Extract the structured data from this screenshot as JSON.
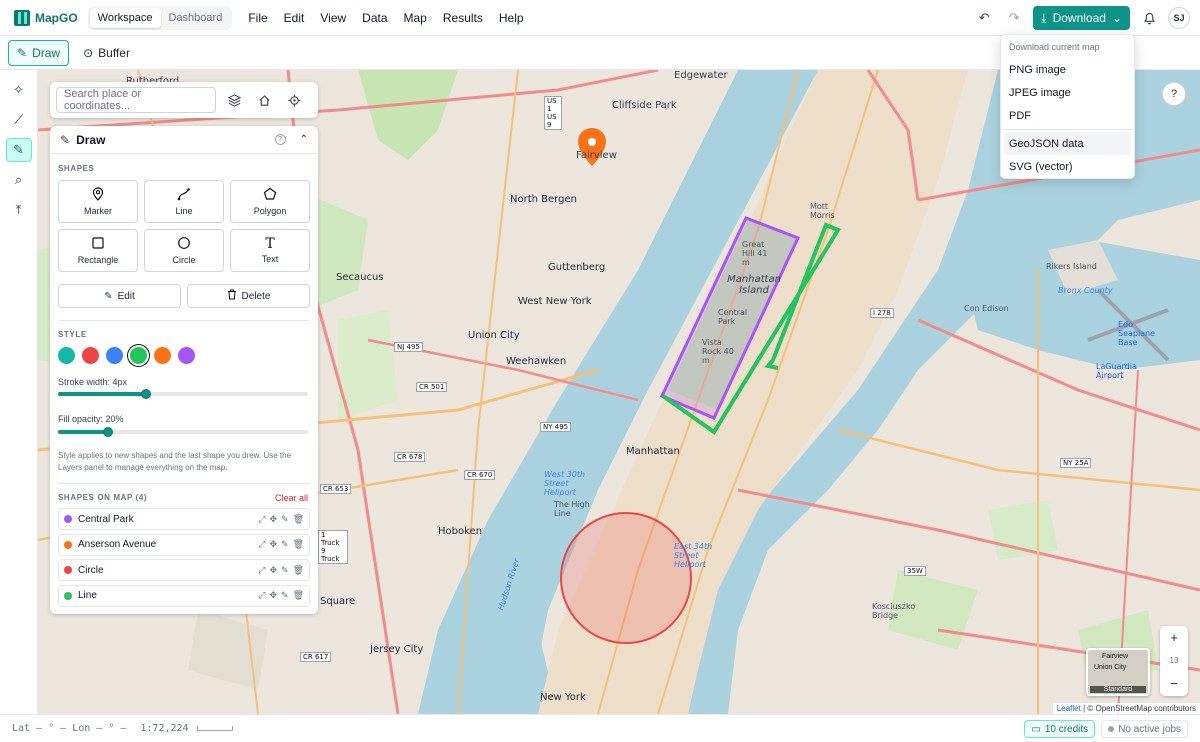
{
  "app": {
    "name": "MapGO"
  },
  "workspace_tabs": [
    {
      "label": "Workspace",
      "active": true
    },
    {
      "label": "Dashboard",
      "active": false
    }
  ],
  "menu": [
    "File",
    "Edit",
    "View",
    "Data",
    "Map",
    "Results",
    "Help"
  ],
  "topbar": {
    "download_label": "Download",
    "avatar_initials": "SJ",
    "accent": "#0d9488"
  },
  "toolbar2": {
    "draw_label": "Draw",
    "buffer_label": "Buffer"
  },
  "search": {
    "placeholder": "Search place or coordinates..."
  },
  "draw_panel": {
    "title": "Draw",
    "shapes_label": "SHAPES",
    "shapes": [
      {
        "label": "Marker",
        "icon": "marker-icon"
      },
      {
        "label": "Line",
        "icon": "line-icon"
      },
      {
        "label": "Polygon",
        "icon": "polygon-icon"
      },
      {
        "label": "Rectangle",
        "icon": "rectangle-icon"
      },
      {
        "label": "Circle",
        "icon": "circle-icon"
      },
      {
        "label": "Text",
        "icon": "text-icon"
      }
    ],
    "edit_label": "Edit",
    "delete_label": "Delete",
    "style_label": "STYLE",
    "colors": [
      "#14b8a6",
      "#ef4444",
      "#3b82f6",
      "#22c55e",
      "#f97316",
      "#a855f7"
    ],
    "selected_color": "#22c55e",
    "stroke_width_label": "Stroke width: 4px",
    "stroke_width": 4,
    "stroke_width_fraction": 0.35,
    "fill_opacity_label": "Fill opacity: 20%",
    "fill_opacity": 0.2,
    "help_text": "Style applies to new shapes and the last shape you drew. Use the Layers panel to manage everything on the map.",
    "shapes_on_map_label": "SHAPES ON MAP (4)",
    "clear_all_label": "Clear all",
    "shapes_on_map": [
      {
        "label": "Central Park",
        "color": "#a855f7"
      },
      {
        "label": "Anserson Avenue",
        "color": "#f97316"
      },
      {
        "label": "Circle",
        "color": "#ef4444"
      },
      {
        "label": "Line",
        "color": "#22c55e"
      }
    ]
  },
  "download_menu": {
    "header": "Download current map",
    "items": [
      "PNG image",
      "JPEG image",
      "PDF",
      "GeoJSON data",
      "SVG (vector)"
    ],
    "highlighted": "GeoJSON data"
  },
  "map": {
    "zoom_level": "13",
    "minimap_label": "Standard",
    "minimap_places": [
      "Fairview",
      "Union City"
    ],
    "attribution_leaflet": "Leaflet",
    "attribution_osm": "© OpenStreetMap contributors",
    "labels": {
      "rutherford": "Rutherford",
      "edgewater": "Edgewater",
      "cliffside": "Cliffside Park",
      "fairview": "Fairview",
      "north_bergen": "North Bergen",
      "guttenberg": "Guttenberg",
      "west_new_york": "West New York",
      "secaucus": "Secaucus",
      "union_city": "Union City",
      "weehawken": "Weehawken",
      "manhattan": "Manhattan",
      "manhattan_island": "Manhattan Island",
      "central_park": "Central Park",
      "great_hill": "Great Hill 41 m",
      "vista_rock": "Vista Rock 40 m",
      "hoboken": "Hoboken",
      "jersey_city": "Jersey City",
      "new_york": "New York",
      "rikers": "Rikers Island",
      "con_edison": "Con Edison",
      "laguardia": "LaGuardia Airport",
      "kosciuszko": "Kosciuszko Bridge",
      "high_line": "The High Line",
      "heliport_w": "West 30th Street Heliport",
      "heliport_e": "East 34th Street Heliport",
      "bronx_county": "Bronx County",
      "edo_seaplane": "Edo Seaplane Base",
      "morris": "Mott Morris",
      "hudson_river": "Hudson River",
      "square": "Square"
    },
    "shields": [
      "US 1 US 9",
      "NJ 495",
      "CR 501",
      "NY 495",
      "CR 678",
      "CR 670",
      "CR 653",
      "CR 617",
      "I 278",
      "NY 25A",
      "1 Truck 9 Truck",
      "35W"
    ]
  },
  "status": {
    "coords": "Lat — ° – Lon — ° –",
    "scale": "1:72,224",
    "credits": "10 credits",
    "jobs": "No active jobs"
  }
}
